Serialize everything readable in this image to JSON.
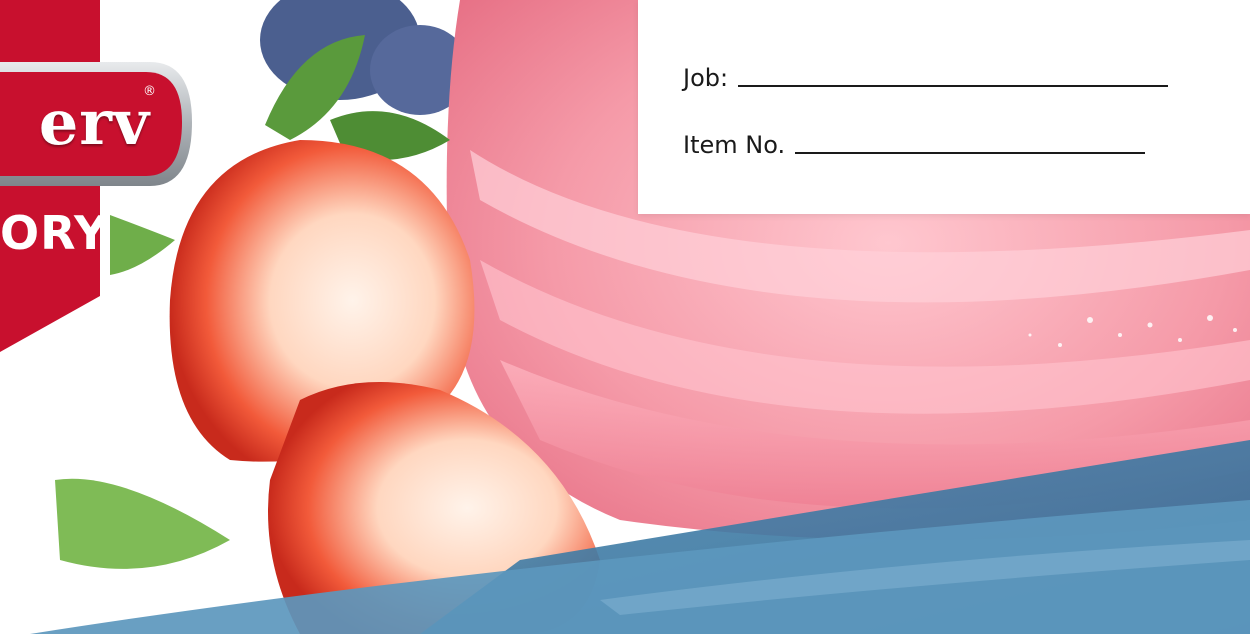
{
  "form": {
    "job_label": "Job:",
    "item_label": "Item No."
  },
  "logo": {
    "wordmark": "erv",
    "registered": "®",
    "banner": "ORY"
  },
  "colors": {
    "badge_red": "#c8102e",
    "badge_silver": "#b9bdc1",
    "wave_blue": "#3f7ea6",
    "sorbet_pink": "#f59aa8"
  },
  "icons": {
    "registered_mark": "registered-icon"
  }
}
